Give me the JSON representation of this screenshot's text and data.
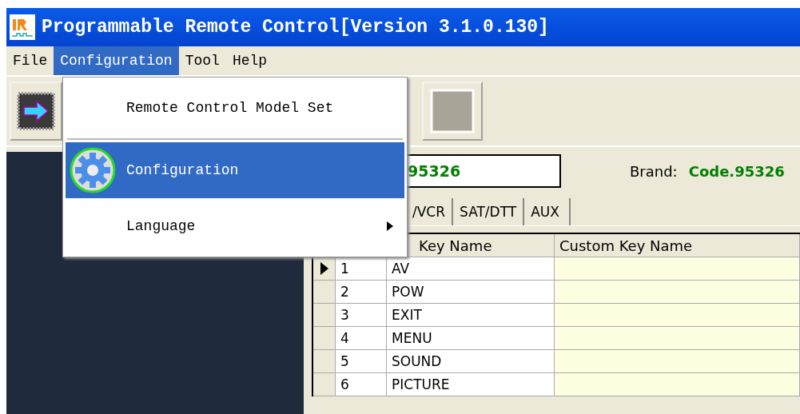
{
  "window": {
    "title": "Programmable Remote Control[Version 3.1.0.130]"
  },
  "menu_bar": [
    {
      "label": "File",
      "selected": false
    },
    {
      "label": "Configuration",
      "selected": true
    },
    {
      "label": "Tool",
      "selected": false
    },
    {
      "label": "Help",
      "selected": false
    }
  ],
  "dropdown": [
    {
      "kind": "item",
      "label": "Remote Control Model Set",
      "selected": false
    },
    {
      "kind": "separator"
    },
    {
      "kind": "icon-item",
      "label": "Configuration",
      "selected": true
    },
    {
      "kind": "submenu",
      "label": "Language",
      "selected": false
    }
  ],
  "code_field": {
    "value": "95326"
  },
  "brand": {
    "label": "Brand:",
    "value": "Code.95326"
  },
  "tabs": [
    {
      "label": "/VCR",
      "selected": false
    },
    {
      "label": "SAT/DTT",
      "selected": false
    },
    {
      "label": "AUX",
      "selected": false
    }
  ],
  "table": {
    "columns": [
      "Key Name",
      "Custom Key Name"
    ],
    "rows": [
      {
        "number": "1",
        "key_name": "AV",
        "current": true
      },
      {
        "number": "2",
        "key_name": "POW",
        "current": false
      },
      {
        "number": "3",
        "key_name": "EXIT",
        "current": false
      },
      {
        "number": "4",
        "key_name": "MENU",
        "current": false
      },
      {
        "number": "5",
        "key_name": "SOUND",
        "current": false
      },
      {
        "number": "6",
        "key_name": "PICTURE",
        "current": false
      }
    ]
  }
}
